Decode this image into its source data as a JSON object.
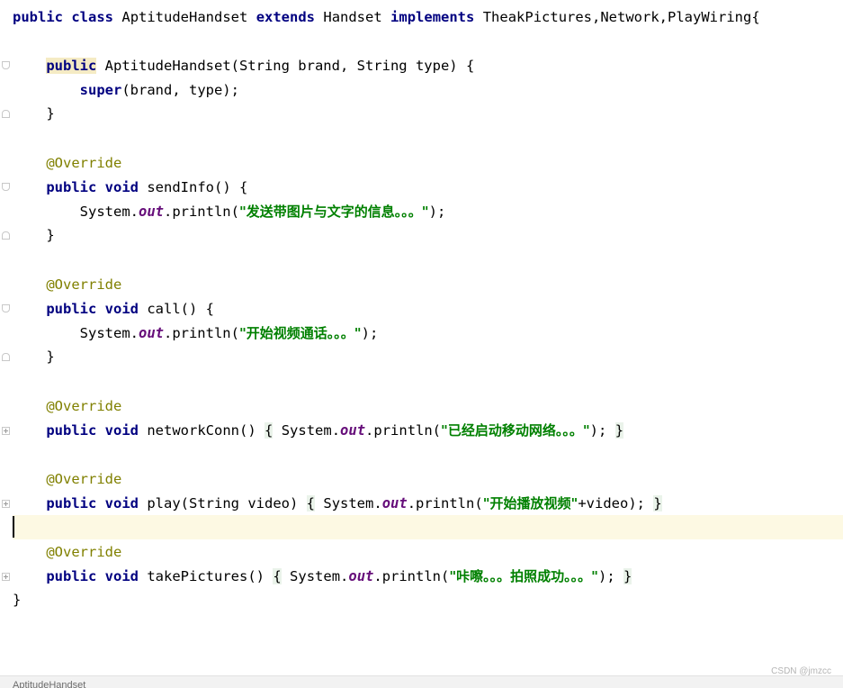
{
  "editor": {
    "lines": [
      {
        "kw1": "public",
        "kw2": "class",
        "name": "AptitudeHandset",
        "kw3": "extends",
        "parent": "Handset",
        "kw4": "implements",
        "ifaces": "TheakPictures,Network,PlayWiring{"
      },
      {
        "kw1": "public",
        "sig": "AptitudeHandset(String brand, String type) {"
      },
      {
        "kw1": "super",
        "rest": "(brand, type);"
      },
      {
        "text": "}"
      },
      {
        "ann": "@Override"
      },
      {
        "kw1": "public",
        "kw2": "void",
        "sig": "sendInfo() {"
      },
      {
        "sys": "System.",
        "field": "out",
        "call": ".println(",
        "str": "\"发送带图片与文字的信息。。。\"",
        "end": ");"
      },
      {
        "text": "}"
      },
      {
        "ann": "@Override"
      },
      {
        "kw1": "public",
        "kw2": "void",
        "sig": "call() {"
      },
      {
        "sys": "System.",
        "field": "out",
        "call": ".println(",
        "str": "\"开始视频通话。。。\"",
        "end": ");"
      },
      {
        "text": "}"
      },
      {
        "ann": "@Override"
      },
      {
        "kw1": "public",
        "kw2": "void",
        "sig": "networkConn()",
        "open": "{",
        "sys": "System.",
        "field": "out",
        "call": ".println(",
        "str": "\"已经启动移动网络。。。\"",
        "end": ");",
        "close": "}"
      },
      {
        "ann": "@Override"
      },
      {
        "kw1": "public",
        "kw2": "void",
        "sig": "play(String video)",
        "open": "{",
        "sys": "System.",
        "field": "out",
        "call": ".println(",
        "str": "\"开始播放视频\"",
        "end": "+video);",
        "close": "}"
      },
      {
        "ann": "@Override"
      },
      {
        "kw1": "public",
        "kw2": "void",
        "sig": "takePictures()",
        "open": "{",
        "sys": "System.",
        "field": "out",
        "call": ".println(",
        "str": "\"咔嚓。。。拍照成功。。。\"",
        "end": ");",
        "close": "}"
      },
      {
        "text": "}"
      }
    ]
  },
  "statusbar": {
    "breadcrumb": "AptitudeHandset"
  },
  "watermark": "CSDN @jmzcc",
  "colors": {
    "keyword": "#000080",
    "annotation": "#808000",
    "string": "#008000",
    "field": "#660e7a",
    "caret_line": "#fdf9e3",
    "folded_brace_bg": "#eaf3ea"
  }
}
